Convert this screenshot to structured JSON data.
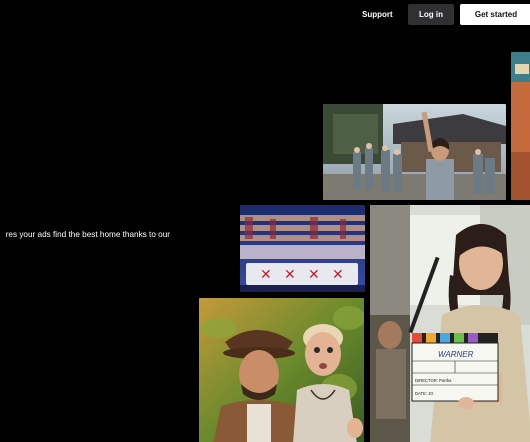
{
  "header": {
    "support_label": "Support",
    "login_label": "Log in",
    "get_started_label": "Get started"
  },
  "hero": {
    "text": "res your ads find the best home thanks to our"
  },
  "clapperboard": {
    "title": "WARNER",
    "director": "DIRECTOR: Partha",
    "date": "DATE: JG"
  },
  "colors": {
    "background": "#000000",
    "login_bg": "#303033",
    "get_started_bg": "#ffffff"
  }
}
